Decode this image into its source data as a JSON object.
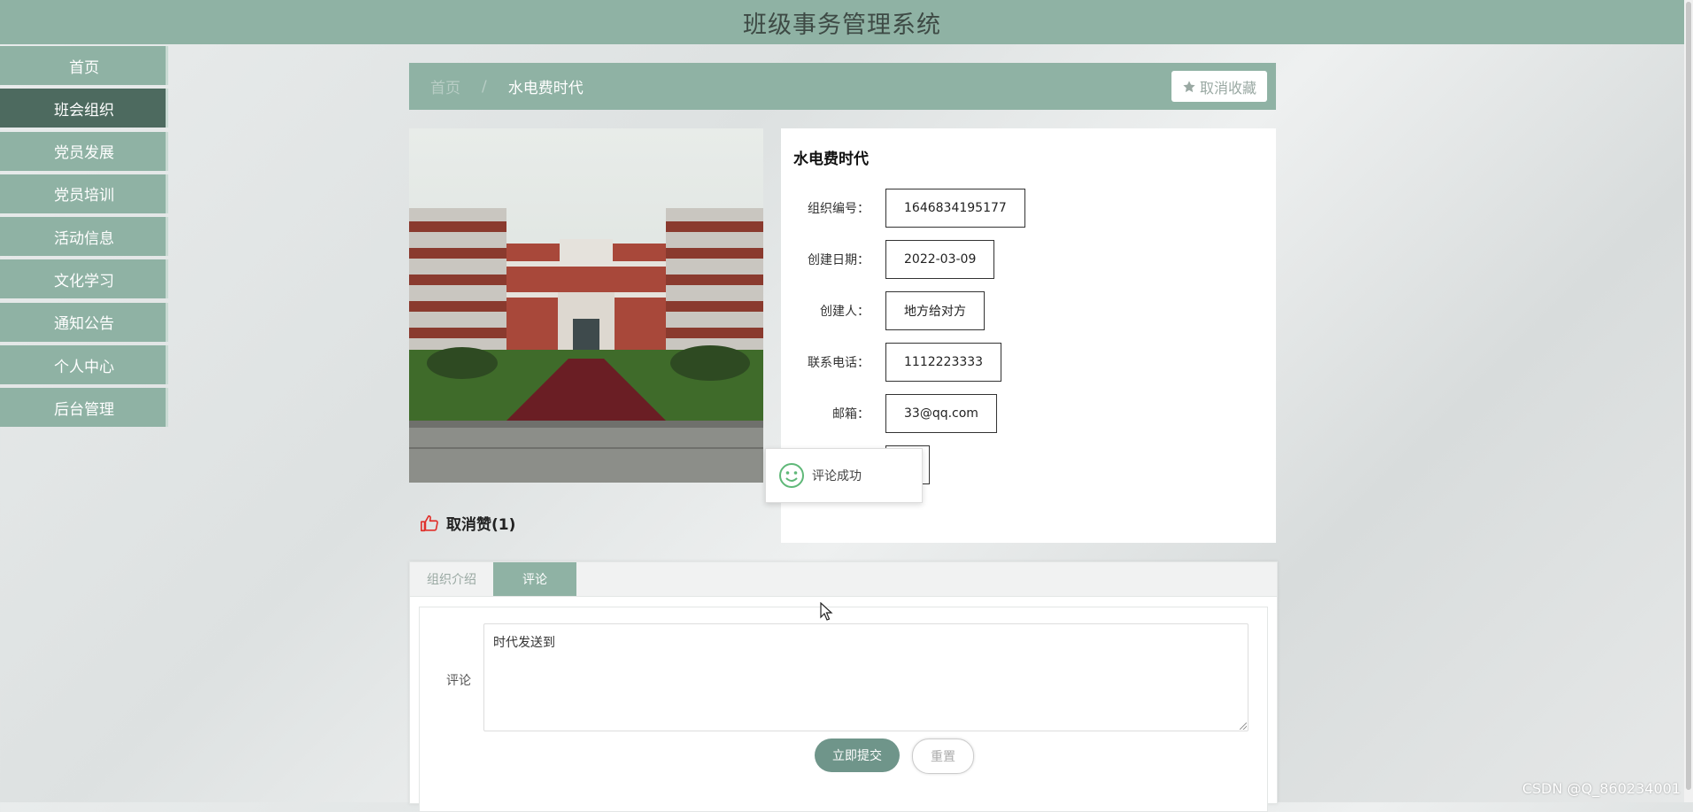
{
  "header": {
    "title": "班级事务管理系统"
  },
  "sidebar": {
    "items": [
      {
        "label": "首页"
      },
      {
        "label": "班会组织"
      },
      {
        "label": "党员发展"
      },
      {
        "label": "党员培训"
      },
      {
        "label": "活动信息"
      },
      {
        "label": "文化学习"
      },
      {
        "label": "通知公告"
      },
      {
        "label": "个人中心"
      },
      {
        "label": "后台管理"
      }
    ],
    "active_index": 1
  },
  "breadcrumb": {
    "home": "首页",
    "current": "水电费时代"
  },
  "favorite_button": {
    "label": "取消收藏",
    "icon": "star-icon"
  },
  "detail": {
    "title": "水电费时代",
    "fields": [
      {
        "label": "组织编号：",
        "value": "1646834195177"
      },
      {
        "label": "创建日期：",
        "value": "2022-03-09"
      },
      {
        "label": "创建人：",
        "value": "地方给对方"
      },
      {
        "label": "联系电话：",
        "value": "1112223333"
      },
      {
        "label": "邮箱：",
        "value": "33@qq.com"
      }
    ]
  },
  "toast": {
    "message": "评论成功",
    "icon": "smile-icon"
  },
  "like": {
    "label": "取消赞(1)",
    "icon": "thumbs-up-icon"
  },
  "tabs": [
    {
      "label": "组织介绍"
    },
    {
      "label": "评论"
    }
  ],
  "comment_form": {
    "label": "评论",
    "value": "时代发送到",
    "submit_label": "立即提交",
    "reset_label": "重置"
  },
  "watermark": "CSDN @Q_860234001",
  "colors": {
    "primary": "#8fb2a4",
    "active": "#4d6a5f",
    "button": "#6f958a"
  }
}
